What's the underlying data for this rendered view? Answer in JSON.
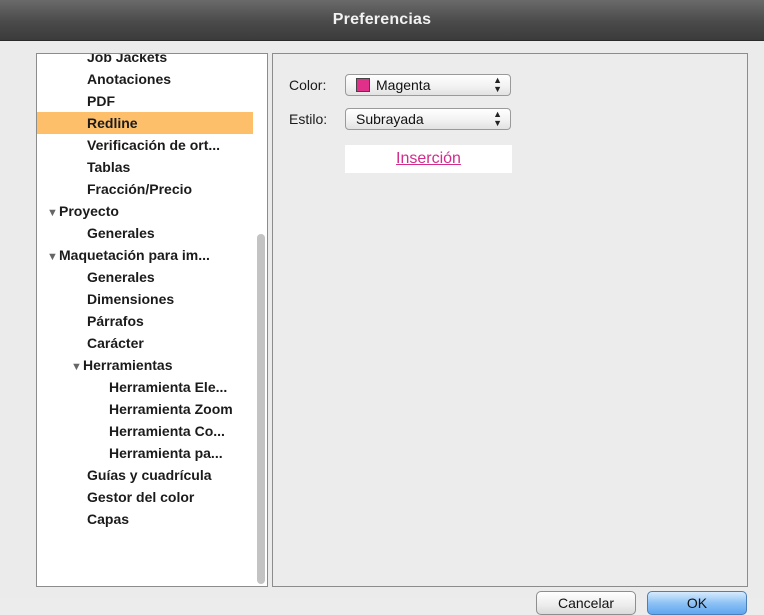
{
  "window": {
    "title": "Preferencias"
  },
  "sidebar": {
    "items": [
      {
        "label": "Job Jackets",
        "level": 1
      },
      {
        "label": "Anotaciones",
        "level": 1
      },
      {
        "label": "PDF",
        "level": 1
      },
      {
        "label": "Redline",
        "level": 1,
        "selected": true
      },
      {
        "label": "Verificación de ort...",
        "level": 1
      },
      {
        "label": "Tablas",
        "level": 1
      },
      {
        "label": "Fracción/Precio",
        "level": 1
      },
      {
        "label": "Proyecto",
        "level": 0,
        "expanded": true
      },
      {
        "label": "Generales",
        "level": 1
      },
      {
        "label": "Maquetación para im...",
        "level": 0,
        "expanded": true
      },
      {
        "label": "Generales",
        "level": 1
      },
      {
        "label": "Dimensiones",
        "level": 1
      },
      {
        "label": "Párrafos",
        "level": 1
      },
      {
        "label": "Carácter",
        "level": 1
      },
      {
        "label": "Herramientas",
        "level": "1t",
        "expanded": true
      },
      {
        "label": "Herramienta Ele...",
        "level": 2
      },
      {
        "label": "Herramienta Zoom",
        "level": 2
      },
      {
        "label": "Herramienta Co...",
        "level": 2
      },
      {
        "label": "Herramienta pa...",
        "level": 2
      },
      {
        "label": "Guías y cuadrícula",
        "level": 1
      },
      {
        "label": "Gestor del color",
        "level": 1
      },
      {
        "label": "Capas",
        "level": 1
      }
    ]
  },
  "settings": {
    "color_label": "Color:",
    "color_value": "Magenta",
    "color_swatch": "#e0308a",
    "style_label": "Estilo:",
    "style_value": "Subrayada",
    "preview_text": "Inserción",
    "preview_color": "#d22b8c",
    "arrow_up": "▲",
    "arrow_down": "▼"
  },
  "buttons": {
    "cancel": "Cancelar",
    "ok": "OK"
  },
  "colors": {
    "selection": "#fdbf6a",
    "accent_button": "#6ab0f3"
  }
}
